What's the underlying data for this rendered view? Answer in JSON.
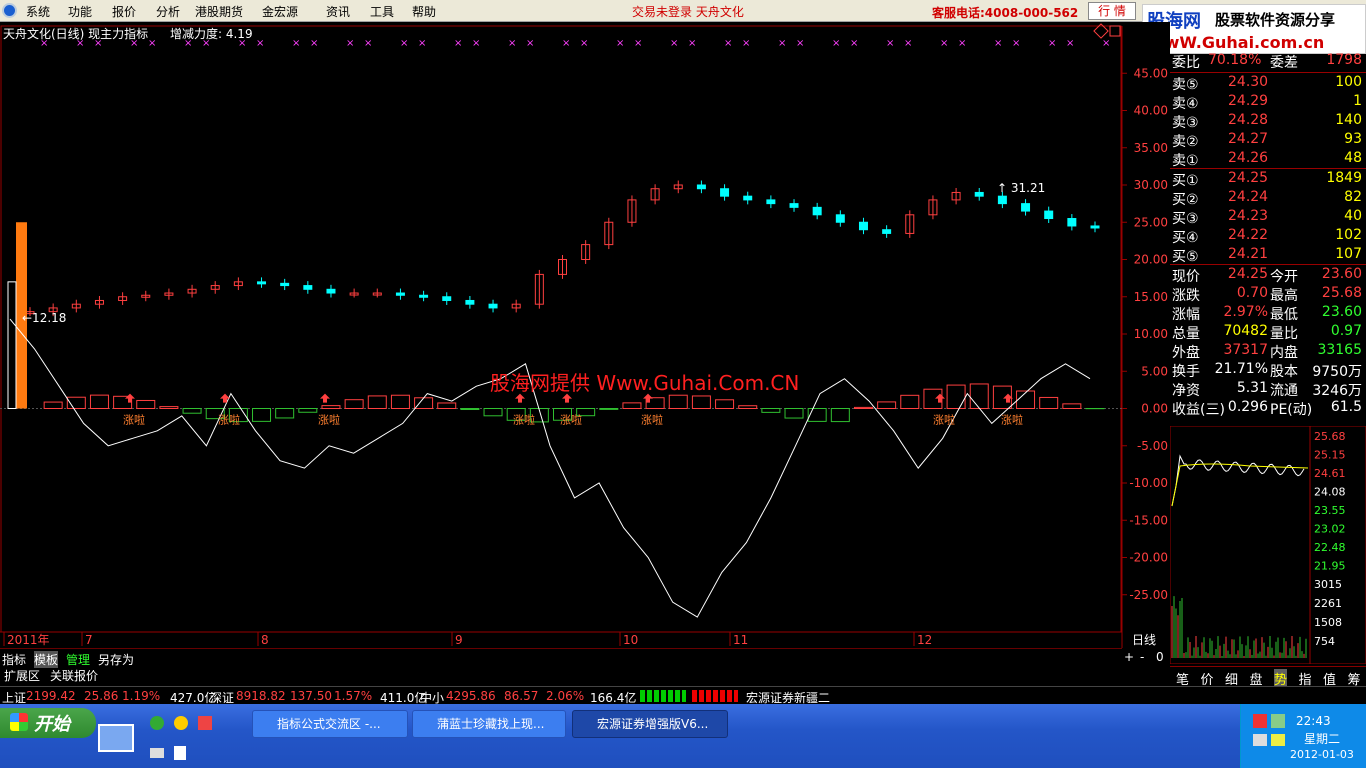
{
  "menu": {
    "items": [
      "系统",
      "功能",
      "报价",
      "分析",
      "港股期货",
      "金宏源",
      "资讯",
      "工具",
      "帮助"
    ],
    "login_status": "交易未登录  天舟文化",
    "hotline": "客服电话:4008-000-562",
    "quote_button": "行  情"
  },
  "logo": {
    "brand": "股海网",
    "slogan": "股票软件资源分享",
    "url": "WwW.Guhai.com.cn"
  },
  "chart": {
    "title": "天舟文化(日线) 现主力指标",
    "indicator": "增减力度: 4.19",
    "watermark": "股海网提供 Www.Guhai.Com.CN",
    "right_axis_ticks": [
      "45.00",
      "40.00",
      "35.00",
      "30.00",
      "25.00",
      "20.00",
      "15.00",
      "10.00",
      "5.00",
      "0.00",
      "-5.00",
      "-10.00",
      "-15.00",
      "-20.00",
      "-25.00"
    ],
    "date_axis": [
      "2011年",
      "7",
      "8",
      "9",
      "10",
      "11",
      "12"
    ],
    "period_label": "日线",
    "high_label": "31.21",
    "low_label": "12.18",
    "signal_text": "涨啦"
  },
  "chart_data": {
    "type": "candlestick",
    "title": "天舟文化(日线)",
    "ylim": [
      -30,
      50
    ],
    "x_labels": [
      "7",
      "8",
      "9",
      "10",
      "11",
      "12"
    ],
    "close_approx": [
      13,
      13.5,
      14,
      14.5,
      15,
      15.2,
      15.5,
      16,
      16.5,
      17,
      16.8,
      16.5,
      16,
      15.5,
      15.5,
      15.5,
      15.2,
      15,
      14.5,
      14,
      13.5,
      14,
      18,
      20,
      22,
      25,
      28,
      29.5,
      30,
      29.5,
      28.5,
      28,
      27.5,
      27,
      26,
      25,
      24,
      23.5,
      26,
      28,
      29,
      28.5,
      27.5,
      26.5,
      25.5,
      24.5,
      24.25
    ],
    "indicator_approx": [
      12,
      8,
      3,
      -2,
      -5,
      -4,
      -3,
      -1,
      -5,
      2,
      -3,
      -7,
      -8,
      -5,
      -6,
      -4,
      -2,
      2,
      1,
      3,
      4,
      6,
      -5,
      -12,
      -10,
      -16,
      -20,
      -26,
      -28,
      -22,
      -18,
      -12,
      -5,
      2,
      4,
      1,
      -3,
      -8,
      -4,
      2,
      -2,
      1,
      4,
      6,
      4
    ],
    "high": 31.21,
    "low": 12.18
  },
  "quote": {
    "weibi": {
      "label": "委比",
      "value": "70.18%",
      "label2": "委差",
      "value2": "1798"
    },
    "sell": [
      {
        "label": "卖⑤",
        "price": "24.30",
        "vol": "100"
      },
      {
        "label": "卖④",
        "price": "24.29",
        "vol": "1"
      },
      {
        "label": "卖③",
        "price": "24.28",
        "vol": "140"
      },
      {
        "label": "卖②",
        "price": "24.27",
        "vol": "93"
      },
      {
        "label": "卖①",
        "price": "24.26",
        "vol": "48"
      }
    ],
    "buy": [
      {
        "label": "买①",
        "price": "24.25",
        "vol": "1849"
      },
      {
        "label": "买②",
        "price": "24.24",
        "vol": "82"
      },
      {
        "label": "买③",
        "price": "24.23",
        "vol": "40"
      },
      {
        "label": "买④",
        "price": "24.22",
        "vol": "102"
      },
      {
        "label": "买⑤",
        "price": "24.21",
        "vol": "107"
      }
    ],
    "stats": [
      {
        "l1": "现价",
        "v1": "24.25",
        "l2": "今开",
        "v2": "23.60"
      },
      {
        "l1": "涨跌",
        "v1": "0.70",
        "l2": "最高",
        "v2": "25.68"
      },
      {
        "l1": "涨幅",
        "v1": "2.97%",
        "l2": "最低",
        "v2": "23.60"
      },
      {
        "l1": "总量",
        "v1": "70482",
        "l2": "量比",
        "v2": "0.97"
      },
      {
        "l1": "外盘",
        "v1": "37317",
        "l2": "内盘",
        "v2": "33165"
      },
      {
        "l1": "换手",
        "v1": "21.71%",
        "l2": "股本",
        "v2": "9750万"
      },
      {
        "l1": "净资",
        "v1": "5.31",
        "l2": "流通",
        "v2": "3246万"
      },
      {
        "l1": "收益(三)",
        "v1": "0.296",
        "l2": "PE(动)",
        "v2": "61.5"
      }
    ]
  },
  "mini": {
    "price_ticks": [
      "25.68",
      "25.15",
      "24.61",
      "24.08",
      "23.55",
      "23.02",
      "22.48",
      "21.95"
    ],
    "vol_ticks": [
      "3015",
      "2261",
      "1508",
      "754"
    ]
  },
  "right_tabs": [
    "笔",
    "价",
    "细",
    "盘",
    "势",
    "指",
    "值",
    "筹"
  ],
  "bottom_tabs1": [
    "指标",
    "模板",
    "管理",
    "另存为"
  ],
  "bottom_tabs2": [
    "扩展区",
    "关联报价"
  ],
  "toolbar_right": [
    "+",
    "-",
    "0"
  ],
  "ticker": {
    "sh_label": "上证",
    "sh_val": "2199.42",
    "sh_chg": "25.86",
    "sh_pct": "1.19%",
    "sh_amt": "427.0亿",
    "sz_label": "深证",
    "sz_val": "8918.82",
    "sz_chg": "137.50",
    "sz_pct": "1.57%",
    "sz_amt": "411.0亿",
    "zx_label": "中小",
    "zx_val": "4295.86",
    "zx_chg": "86.57",
    "zx_pct": "2.06%",
    "zx_amt": "166.4亿",
    "broker": "宏源证券新疆二"
  },
  "taskbar": {
    "start": "开始",
    "tasks": [
      "指标公式交流区 -...",
      "蒲蓝士珍藏找上现...",
      "宏源证券增强版V6..."
    ],
    "time": "22:43",
    "weekday": "星期二",
    "date": "2012-01-03"
  },
  "colors": {
    "up": "#ff4040",
    "down": "#00ffff",
    "bg": "#000000",
    "grid": "#800000"
  }
}
